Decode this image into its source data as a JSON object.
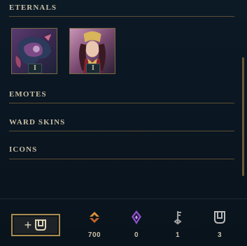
{
  "sections": {
    "eternals": "ETERNALS",
    "emotes": "EMOTES",
    "ward_skins": "WARD SKINS",
    "icons": "ICONS"
  },
  "eternals": [
    {
      "badge": "I",
      "icon": "champion-portrait-1"
    },
    {
      "badge": "I",
      "icon": "champion-portrait-2"
    }
  ],
  "footer": {
    "add_button_label": "+",
    "currencies": [
      {
        "icon": "orange-essence-icon",
        "amount": "700",
        "color": "#e0913a"
      },
      {
        "icon": "mythic-essence-icon",
        "amount": "0",
        "color": "#a86bdc"
      },
      {
        "icon": "key-icon",
        "amount": "1",
        "color": "#a0a0a0"
      },
      {
        "icon": "chest-icon",
        "amount": "3",
        "color": "#b9b9b9"
      }
    ]
  },
  "colors": {
    "gold_border": "#a78b50",
    "divider": "#5c4f33",
    "text": "#c9bfa6",
    "background": "#0b1621"
  }
}
